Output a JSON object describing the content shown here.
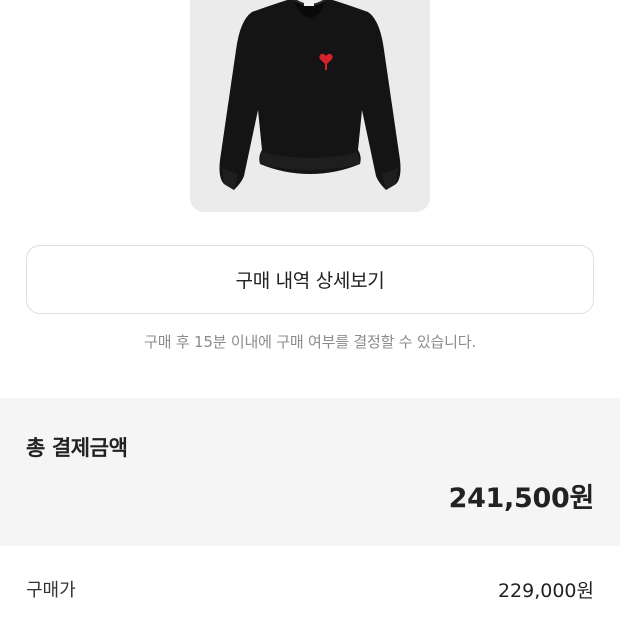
{
  "product": {
    "image_alt": "black sweater with red heart logo"
  },
  "detail_button": {
    "label": "구매 내역 상세보기"
  },
  "notice": {
    "text": "구매 후 15분 이내에 구매 여부를 결정할 수 있습니다."
  },
  "total": {
    "label": "총 결제금액",
    "amount": "241,500원"
  },
  "purchase_price": {
    "label": "구매가",
    "value": "229,000원"
  },
  "colors": {
    "card_background": "#ebebeb",
    "section_background": "#f5f5f5",
    "logo_red": "#d4232b"
  }
}
